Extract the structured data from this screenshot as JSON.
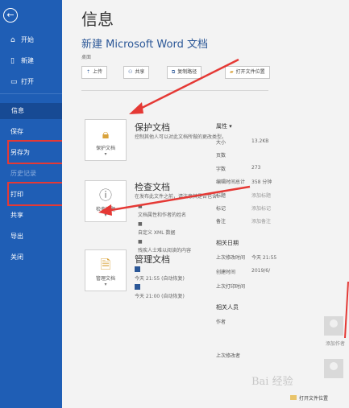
{
  "sidebar": {
    "back_icon": "arrow-left-icon",
    "items": [
      {
        "label": "开始",
        "icon": "home-icon"
      },
      {
        "label": "新建",
        "icon": "new-doc-icon"
      },
      {
        "label": "打开",
        "icon": "folder-open-icon"
      },
      {
        "label": "信息"
      },
      {
        "label": "保存"
      },
      {
        "label": "另存为"
      },
      {
        "label": "历史记录"
      },
      {
        "label": "打印"
      },
      {
        "label": "共享"
      },
      {
        "label": "导出"
      },
      {
        "label": "关闭"
      }
    ]
  },
  "main": {
    "title": "信息",
    "doc_name": "新建 Microsoft Word 文档",
    "location": "桌面",
    "buttons": {
      "upload": "上传",
      "share": "共享",
      "copy_path": "复制路径",
      "open_location": "打开文件位置"
    },
    "protect": {
      "tile_label": "保护文档",
      "title": "保护文档",
      "desc": "控制其他人可以对此文档所做的更改类型。"
    },
    "inspect": {
      "tile_label": "检查问题",
      "title": "检查文档",
      "desc": "在发布此文件之前，请注意其是否包含:",
      "bullets": [
        "文档属性和作者的姓名",
        "自定义 XML 数据",
        "残疾人士难以阅读的内容"
      ]
    },
    "manage": {
      "tile_label": "管理文档",
      "title": "管理文档",
      "versions": [
        "今天 21:55 (自动恢复)",
        "今天 21:00 (自动恢复)"
      ]
    }
  },
  "props": {
    "header": "属性",
    "rows": [
      {
        "k": "大小",
        "v": "13.2KB"
      },
      {
        "k": "页数",
        "v": ""
      },
      {
        "k": "字数",
        "v": "273"
      },
      {
        "k": "编辑时间总计",
        "v": "358 分钟"
      },
      {
        "k": "标题",
        "v": "添加标题"
      },
      {
        "k": "标记",
        "v": "添加标记"
      },
      {
        "k": "备注",
        "v": "添加备注"
      }
    ],
    "dates_header": "相关日期",
    "dates": [
      {
        "k": "上次修改时间",
        "v": "今天 21:55"
      },
      {
        "k": "创建时间",
        "v": "2019/6/"
      },
      {
        "k": "上次打印时间",
        "v": ""
      }
    ],
    "people_header": "相关人员",
    "author_label": "作者",
    "author_add": "添加作者",
    "modified_by_label": "上次修改者",
    "open_location": "打开文件位置"
  },
  "watermark": "Bai 经验"
}
